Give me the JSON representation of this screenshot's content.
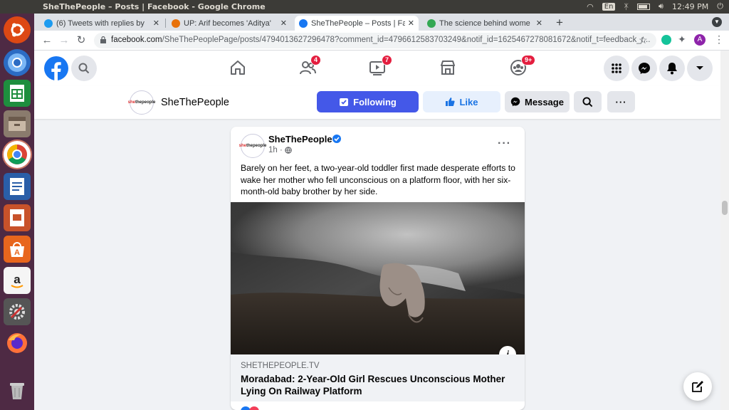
{
  "os": {
    "window_title": "SheThePeople – Posts | Facebook - Google Chrome",
    "keyboard_layout": "En",
    "clock": "12:49 PM"
  },
  "launcher": {
    "items": [
      "ubuntu-icon",
      "chromium-icon",
      "spreadsheet-icon",
      "files-icon",
      "chrome-icon",
      "writer-icon",
      "impress-icon",
      "software-center-icon",
      "amazon-icon",
      "settings-icon",
      "firefox-icon",
      "trash-icon"
    ]
  },
  "tabs": [
    {
      "title": "(6) Tweets with replies by",
      "icon": "twitter-icon",
      "color": "#1d9bf0"
    },
    {
      "title": "UP: Arif becomes 'Aditya'",
      "icon": "news-icon",
      "color": "#e8710a"
    },
    {
      "title": "SheThePeople – Posts | Fa",
      "icon": "facebook-icon",
      "color": "#1877f2",
      "active": true
    },
    {
      "title": "The science behind wome",
      "icon": "globe-icon",
      "color": "#34a853"
    }
  ],
  "new_tab_label": "+",
  "address": {
    "host": "facebook.com",
    "path": "/SheThePeoplePage/posts/4794013627296478?comment_id=4796612583703249&notif_id=1625467278081672&notif_t=feedback_r..."
  },
  "profile_initial": "A",
  "fb_nav": {
    "friends_badge": "4",
    "watch_badge": "7",
    "groups_badge": "9+"
  },
  "page_header": {
    "name": "SheThePeople",
    "logo_text": [
      "she",
      "the",
      "people"
    ],
    "following_label": "Following",
    "like_label": "Like",
    "message_label": "Message",
    "more_label": "···"
  },
  "post": {
    "author": "SheThePeople",
    "time": "1h ·",
    "menu": "···",
    "text": "Barely on her feet, a two-year-old toddler first made desperate efforts to wake her mother who fell unconscious on a platform floor, with her six-month-old baby brother by her side.",
    "link_domain": "SHETHEPEOPLE.TV",
    "link_title": "Moradabad: 2-Year-Old Girl Rescues Unconscious Mother Lying On Railway Platform",
    "info_label": "i"
  },
  "colors": {
    "fb_blue": "#1877f2",
    "following_bg": "#4458e8",
    "like_bg": "#e7f0fd",
    "ubuntu_launcher": "#4e2a44",
    "ubuntu_topbar": "#3c3b37"
  }
}
